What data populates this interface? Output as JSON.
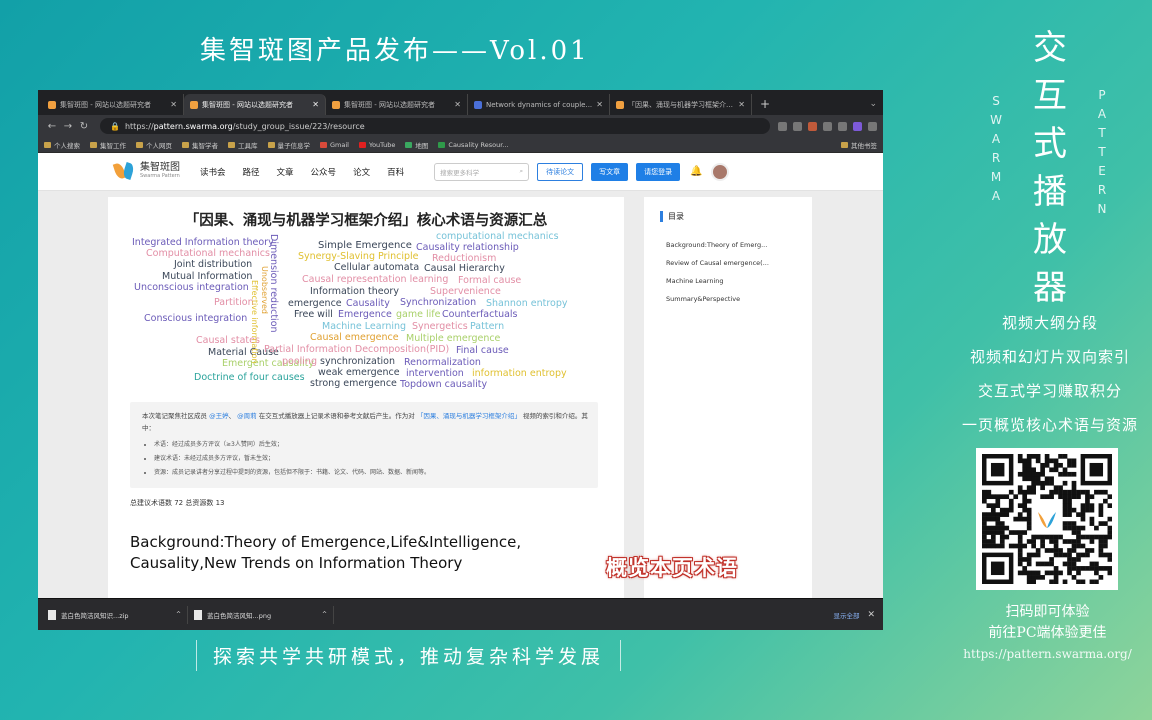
{
  "banner": {
    "title": "集智斑图产品发布——Vol.01",
    "footer": "探索共学共研模式，推动复杂科学发展"
  },
  "side": {
    "vertical_title": [
      "交",
      "互",
      "式",
      "播",
      "放",
      "器"
    ],
    "left_letters": [
      "S",
      "W",
      "A",
      "R",
      "M",
      "A"
    ],
    "right_letters": [
      "P",
      "A",
      "T",
      "T",
      "E",
      "R",
      "N"
    ],
    "features": [
      "视频大纲分段",
      "视频和幻灯片双向索引",
      "交互式学习赚取积分",
      "一页概览核心术语与资源"
    ],
    "qr_caption": [
      "扫码即可体验",
      "前往PC端体验更佳"
    ],
    "url": "https://pattern.swarma.org/"
  },
  "browser": {
    "tabs": [
      {
        "label": "集智斑图 - 网站以选题研究者",
        "active": false
      },
      {
        "label": "集智斑图 - 网站以选题研究者",
        "active": true
      },
      {
        "label": "集智斑图 - 网站以选题研究者",
        "active": false
      },
      {
        "label": "Network dynamics of couple...",
        "active": false
      },
      {
        "label": "「因果、涌现与机器学习框架介绍」",
        "active": false
      }
    ],
    "url_scheme": "https://",
    "url_host": "pattern.swarma.org",
    "url_path": "/study_group_issue/223/resource",
    "bookmarks": [
      "个人搜索",
      "集智工作",
      "个人网页",
      "集智学者",
      "工具库",
      "量子信息学",
      "Gmail",
      "YouTube",
      "地图",
      "Causality Resour..."
    ],
    "bookmarks_right": "其他书签"
  },
  "site": {
    "logo_cn": "集智斑图",
    "logo_en": "Swarma Pattern",
    "nav": [
      "读书会",
      "路径",
      "文章",
      "公众号",
      "论文",
      "百科"
    ],
    "search_placeholder": "搜索更多科学",
    "btn_outline": "待读论文",
    "btn_write": "写文章",
    "btn_login": "请您登录"
  },
  "article": {
    "title": "「因果、涌现与机器学习框架介绍」核心术语与资源汇总",
    "word_cloud": [
      {
        "text": "Integrated Information theory",
        "color": "#6b5bb8"
      },
      {
        "text": "Computational mechanics",
        "color": "#e28ea5"
      },
      {
        "text": "Joint distribution",
        "color": "#3a4658"
      },
      {
        "text": "Mutual Information",
        "color": "#3a4658"
      },
      {
        "text": "Unconscious integration",
        "color": "#6b5bb8"
      },
      {
        "text": "Partition",
        "color": "#e28ea5"
      },
      {
        "text": "Conscious integration",
        "color": "#6b5bb8"
      },
      {
        "text": "Causal states",
        "color": "#e28ea5"
      },
      {
        "text": "Material Cause",
        "color": "#3a4658"
      },
      {
        "text": "Emergent causality",
        "color": "#a9d06a"
      },
      {
        "text": "Doctrine of four causes",
        "color": "#2aa39b"
      },
      {
        "text": "Dimension reduction",
        "color": "#6b5bb8"
      },
      {
        "text": "Unobserved",
        "color": "#e0a030"
      },
      {
        "text": "Effective information",
        "color": "#e0c030"
      },
      {
        "text": "Simple Emergence",
        "color": "#3a4658"
      },
      {
        "text": "computational mechanics",
        "color": "#76c2d8"
      },
      {
        "text": "Causality relationship",
        "color": "#6b5bb8"
      },
      {
        "text": "Synergy-Slaving Principle",
        "color": "#e0c030"
      },
      {
        "text": "Reductionism",
        "color": "#e28ea5"
      },
      {
        "text": "Cellular automata",
        "color": "#3a4658"
      },
      {
        "text": "Causal Hierarchy",
        "color": "#3a4658"
      },
      {
        "text": "Causal representation learning",
        "color": "#e28ea5"
      },
      {
        "text": "Formal cause",
        "color": "#e28ea5"
      },
      {
        "text": "Information theory",
        "color": "#3a4658"
      },
      {
        "text": "Supervenience",
        "color": "#e28ea5"
      },
      {
        "text": "emergence",
        "color": "#3a4658"
      },
      {
        "text": "Causality",
        "color": "#6b5bb8"
      },
      {
        "text": "Synchronization",
        "color": "#6b5bb8"
      },
      {
        "text": "Shannon entropy",
        "color": "#76c2d8"
      },
      {
        "text": "Free will",
        "color": "#3a4658"
      },
      {
        "text": "Emergence",
        "color": "#6b5bb8"
      },
      {
        "text": "game life",
        "color": "#a9d06a"
      },
      {
        "text": "Counterfactuals",
        "color": "#6b5bb8"
      },
      {
        "text": "Machine Learning",
        "color": "#76c2d8"
      },
      {
        "text": "Synergetics",
        "color": "#e28ea5"
      },
      {
        "text": "Pattern",
        "color": "#76c2d8"
      },
      {
        "text": "Causal emergence",
        "color": "#e0a030"
      },
      {
        "text": "Multiple emergence",
        "color": "#a9d06a"
      },
      {
        "text": "Partial Information Decomposition(PID)",
        "color": "#e28ea5"
      },
      {
        "text": "Final cause",
        "color": "#6b5bb8"
      },
      {
        "text": "pooling",
        "color": "#e28ea5"
      },
      {
        "text": "synchronization",
        "color": "#3a4658"
      },
      {
        "text": "Renormalization",
        "color": "#6b5bb8"
      },
      {
        "text": "weak emergence",
        "color": "#3a4658"
      },
      {
        "text": "intervention",
        "color": "#6b5bb8"
      },
      {
        "text": "information entropy",
        "color": "#e0c030"
      },
      {
        "text": "strong emergence",
        "color": "#3a4658"
      },
      {
        "text": "Topdown causality",
        "color": "#6b5bb8"
      }
    ],
    "summary_line1_a": "本次笔记聚焦社区成员",
    "summary_name1": "@王婷",
    "summary_name2": "@周莉",
    "summary_line1_b": "在交互式播放器上记录术语和参考文献后产生。作为对",
    "summary_quote": "「因果、涌现与机器学习框架介绍」",
    "summary_line2": "视频的索引和介绍。其中：",
    "bullets": [
      "术语：经过成员多方评议（≥3人赞同）后生效；",
      "建议术语：未经过成员多方评议，暂未生效；",
      "资源：成员记录讲者分享过程中提到的资源，包括但不限于：书籍、论文、代码、网站、数据、新闻等。"
    ],
    "counts": "总建议术语数 72   总资源数 13",
    "section_heading": "Background:Theory of Emergence,Life&Intelligence, Causality,New Trends on Information Theory"
  },
  "toc": {
    "header": "目录",
    "items": [
      "Background:Theory of Emerg...",
      "Review of Causal emergence(...",
      "Machine Learning",
      "Summary&Perspective"
    ]
  },
  "overlay_caption": "概览本页术语",
  "downloads": {
    "items": [
      "蓝白色简洁风知识...zip",
      "蓝白色简洁风知...png"
    ],
    "show_all": "显示全部"
  }
}
